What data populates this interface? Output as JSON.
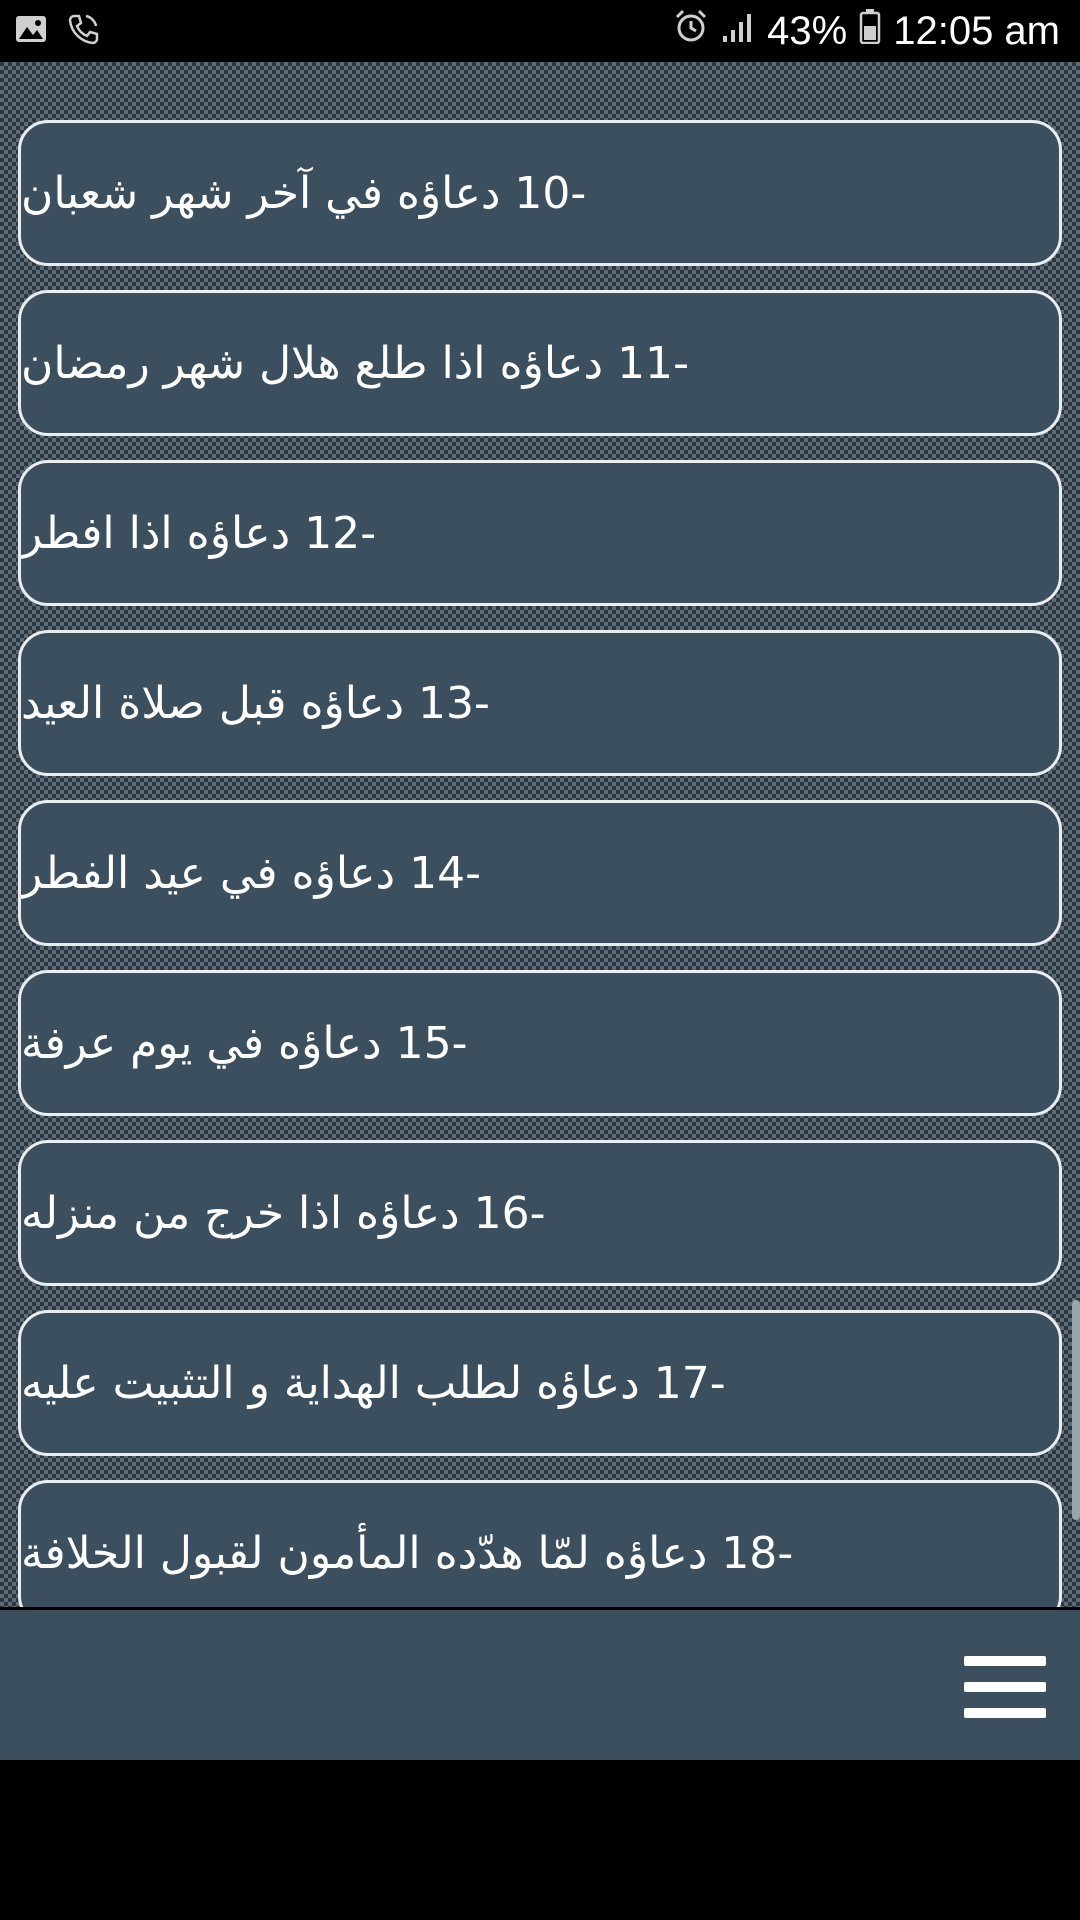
{
  "status_bar": {
    "battery_percent": "43%",
    "time": "12:05 am",
    "icons": [
      "image-icon",
      "phone-call-icon",
      "alarm-icon",
      "signal-icon",
      "battery-icon"
    ]
  },
  "list": {
    "items": [
      {
        "label": "-10  دعاؤه في آخر شهر شعبان"
      },
      {
        "label": "-11  دعاؤه اذا طلع هلال شهر رمضان"
      },
      {
        "label": "-12   دعاؤه اذا افطر"
      },
      {
        "label": "-13  دعاؤه قبل صلاة العيد"
      },
      {
        "label": "-14 دعاؤه في عيد الفطر"
      },
      {
        "label": "-15   دعاؤه في يوم عرفة"
      },
      {
        "label": "-16  دعاؤه اذا خرج من منزله"
      },
      {
        "label": "-17 دعاؤه لطلب الهداية و التثبيت عليه"
      },
      {
        "label": "-18  دعاؤه لمّا هدّده المأمون لقبول الخلافة"
      }
    ]
  },
  "bottom_bar": {
    "menu_icon": "hamburger-menu-icon"
  },
  "colors": {
    "item_background": "#3c4f5e",
    "item_border": "#e9edf0",
    "bottom_bar": "#3c4f5e",
    "pattern_light": "#5d6b77",
    "pattern_dark": "#2b3640"
  }
}
